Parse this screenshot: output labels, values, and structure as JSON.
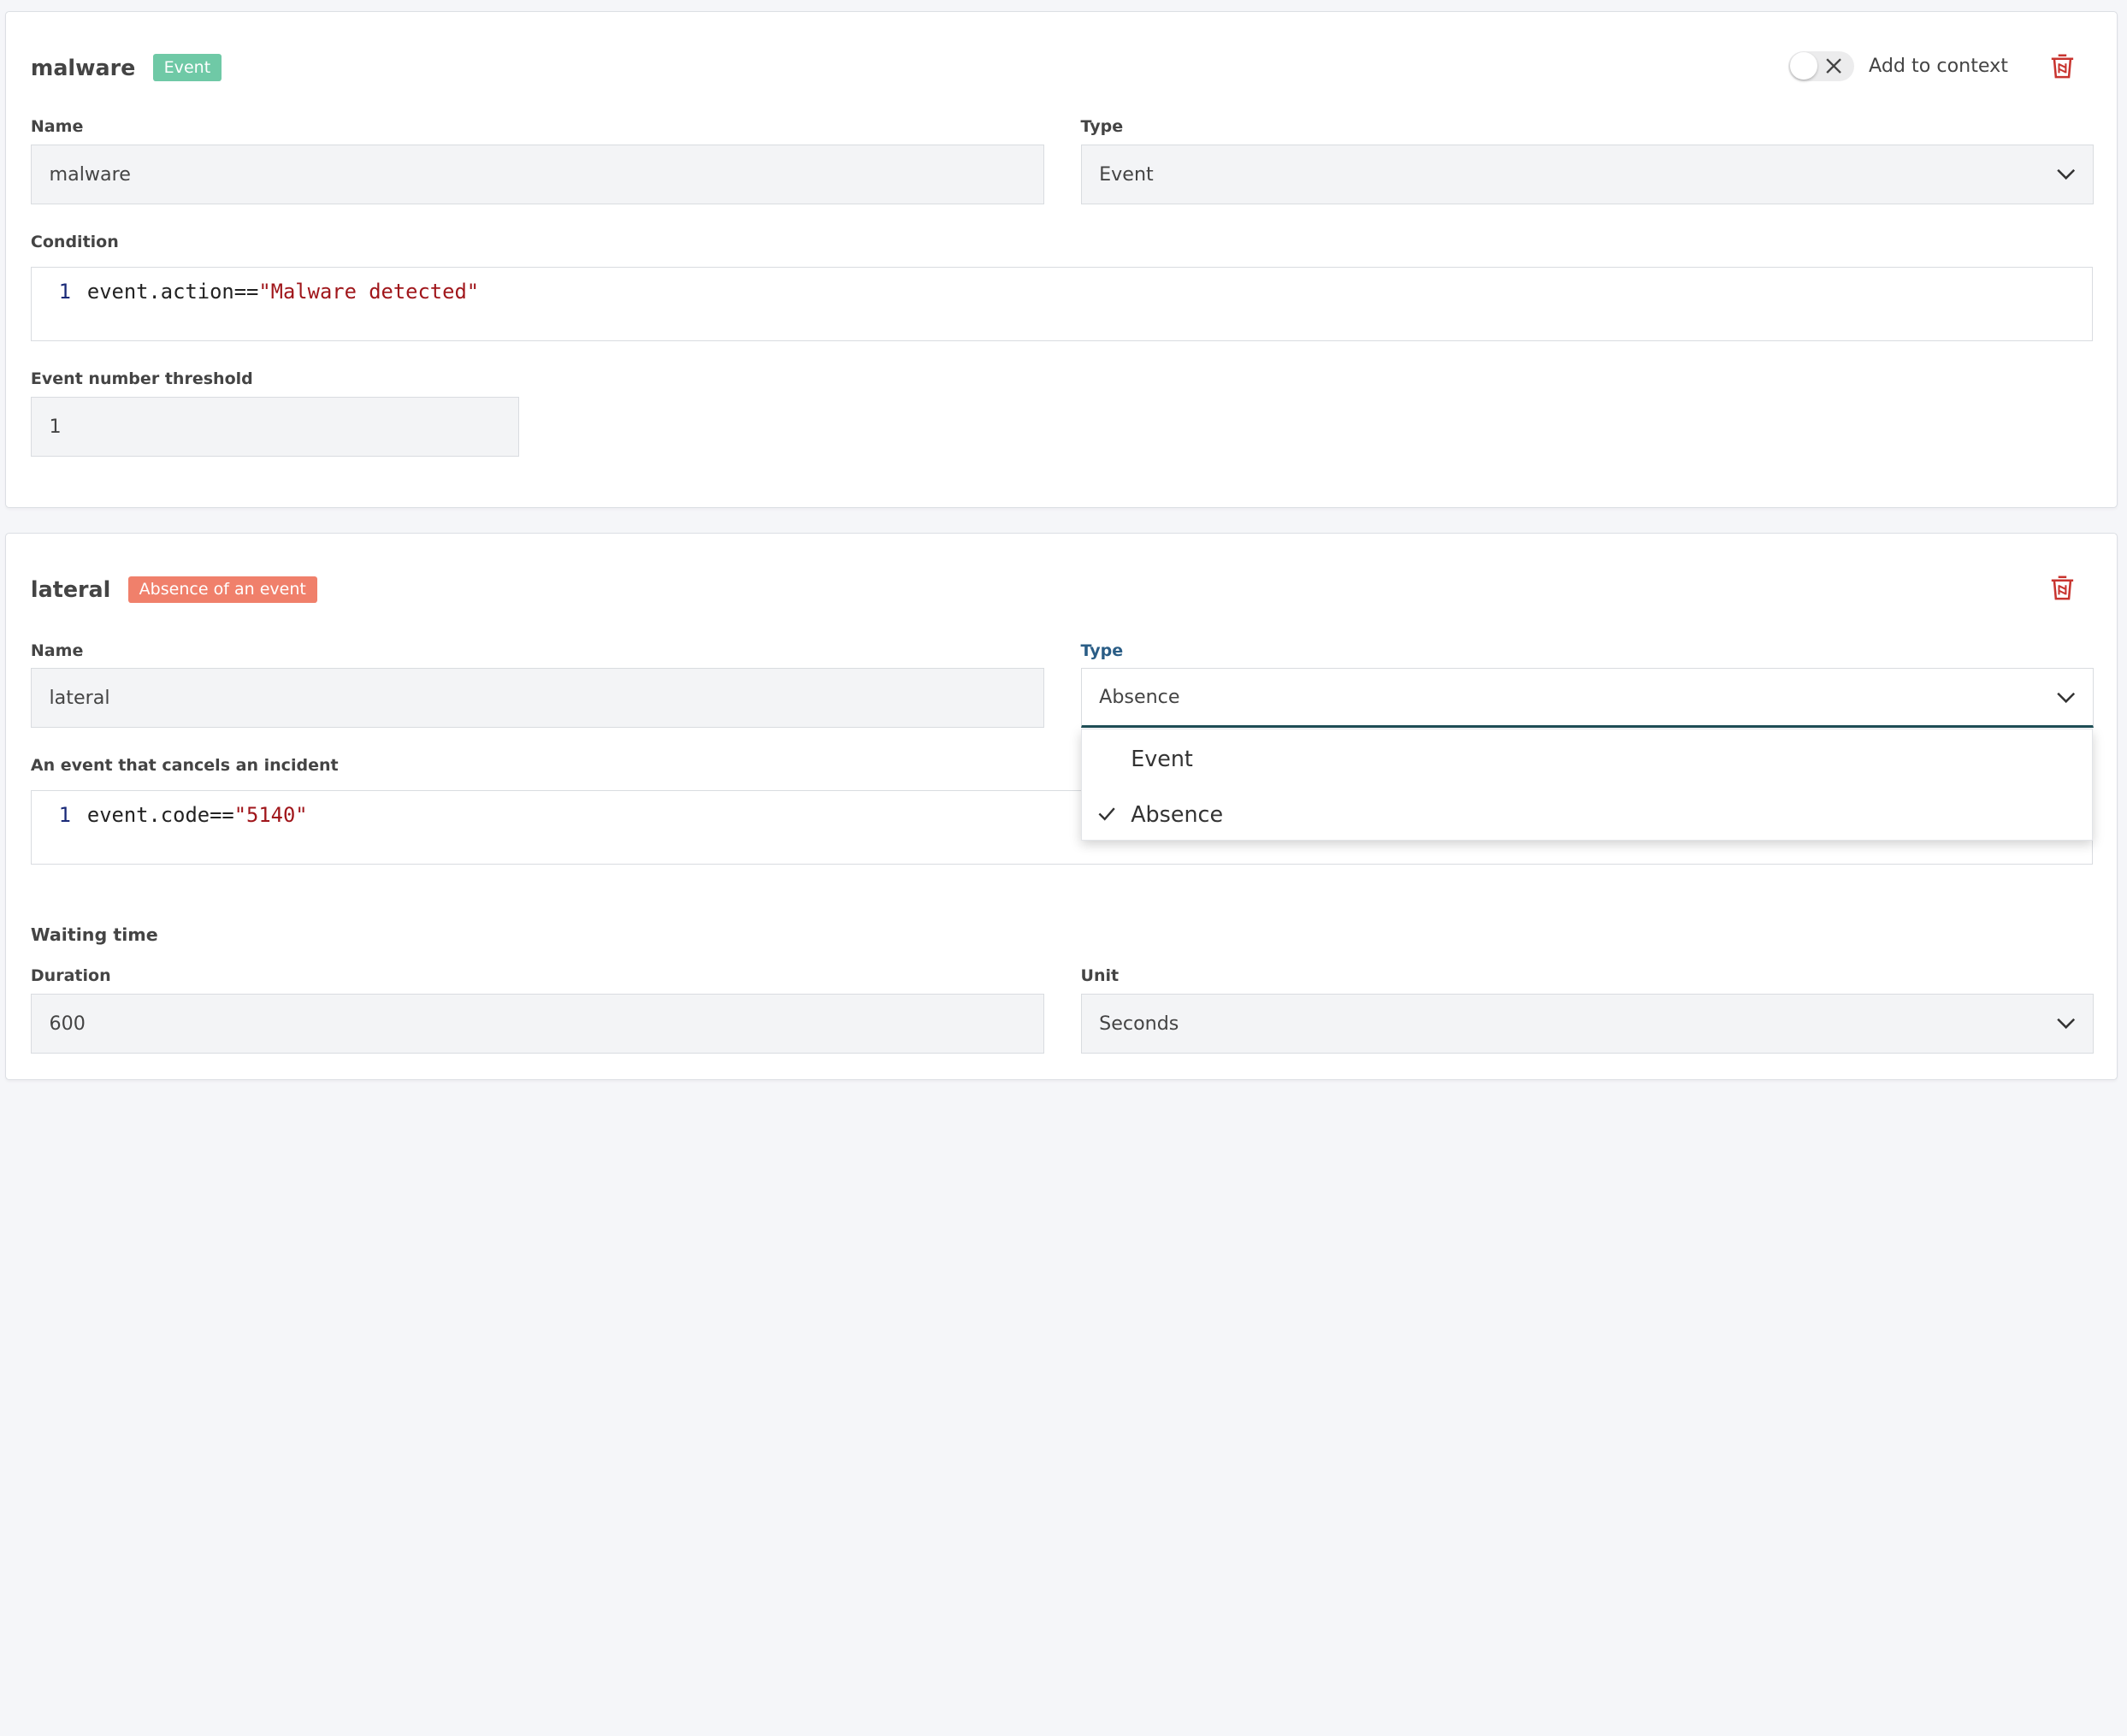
{
  "colors": {
    "event_badge": "#6fc9a6",
    "absence_badge": "#f0806b",
    "delete_icon": "#c8342f",
    "focus_accent": "#1f4f57",
    "code_string": "#a0161b",
    "code_line_number": "#1a2a78"
  },
  "icons": {
    "delete": "trash-icon",
    "toggle_off": "close-icon",
    "select": "chevron-down-icon",
    "selected": "checkmark-icon"
  },
  "card1": {
    "title": "malware",
    "badge": "Event",
    "add_to_context_label": "Add to context",
    "add_to_context_enabled": false,
    "name_label": "Name",
    "name_value": "malware",
    "type_label": "Type",
    "type_value": "Event",
    "condition_label": "Condition",
    "condition_line_number": "1",
    "condition_code_prefix": "event.action==",
    "condition_code_string": "\"Malware detected\"",
    "threshold_label": "Event number threshold",
    "threshold_value": "1"
  },
  "card2": {
    "title": "lateral",
    "badge": "Absence of an event",
    "name_label": "Name",
    "name_value": "lateral",
    "type_label": "Type",
    "type_value": "Absence",
    "type_options": [
      {
        "label": "Event",
        "selected": false
      },
      {
        "label": "Absence",
        "selected": true
      }
    ],
    "cancel_label": "An event that cancels an incident",
    "cancel_line_number": "1",
    "cancel_code_prefix": "event.code==",
    "cancel_code_string": "\"5140\"",
    "waiting_time_title": "Waiting time",
    "duration_label": "Duration",
    "duration_value": "600",
    "unit_label": "Unit",
    "unit_value": "Seconds"
  }
}
